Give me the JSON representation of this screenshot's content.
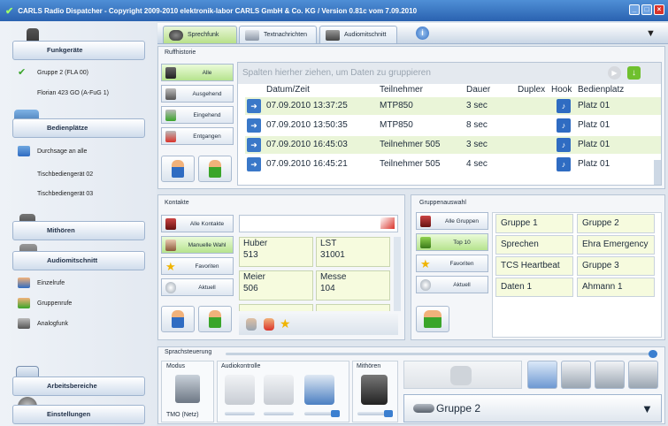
{
  "titlebar": {
    "title": "CARLS Radio Dispatcher   - Copyright 2009-2010 elektronik-labor CARLS GmbH & Co. KG  /  Version 0.81c vom 7.09.2010"
  },
  "sidebar": {
    "funkgeraete": {
      "label": "Funkgeräte",
      "items": [
        "Gruppe 2 (FLA 00)",
        "Florian 423 GO (A-FuG 1)"
      ]
    },
    "bedienplaetze": {
      "label": "Bedienplätze",
      "items": [
        "Durchsage an alle",
        "Tischbediengerät 02",
        "Tischbediengerät 03"
      ]
    },
    "mithoeren": {
      "label": "Mithören"
    },
    "audiomitschnitt": {
      "label": "Audiomitschnitt",
      "items": [
        "Einzelrufe",
        "Gruppenrufe",
        "Analogfunk"
      ]
    },
    "arbeitsbereiche": {
      "label": "Arbeitsbereiche"
    },
    "einstellungen": {
      "label": "Einstellungen"
    }
  },
  "tabs": [
    "Sprechfunk",
    "Textnachrichten",
    "Audiomitschnitt"
  ],
  "ruf": {
    "title": "Ruffhistorie",
    "filters": [
      "Alle",
      "Ausgehend",
      "Eingehend",
      "Entgangen"
    ],
    "grouphint": "Spalten hierher ziehen, um Daten zu gruppieren",
    "columns": [
      "Datum/Zeit",
      "Teilnehmer",
      "Dauer",
      "Duplex",
      "Hook",
      "Bedienplatz"
    ],
    "rows": [
      {
        "dt": "07.09.2010 13:37:25",
        "tn": "MTP850",
        "dauer": "3 sec",
        "bp": "Platz 01"
      },
      {
        "dt": "07.09.2010 13:50:35",
        "tn": "MTP850",
        "dauer": "8 sec",
        "bp": "Platz 01"
      },
      {
        "dt": "07.09.2010 16:45:03",
        "tn": "Teilnehmer 505",
        "dauer": "3 sec",
        "bp": "Platz 01"
      },
      {
        "dt": "07.09.2010 16:45:21",
        "tn": "Teilnehmer 505",
        "dauer": "4 sec",
        "bp": "Platz 01"
      }
    ]
  },
  "kontakte": {
    "title": "Kontakte",
    "filters": [
      "Alle Kontakte",
      "Manuelle Wahl",
      "Favoriten",
      "Aktuell"
    ],
    "cells": [
      {
        "name": "Huber",
        "num": "513"
      },
      {
        "name": "LST",
        "num": "31001"
      },
      {
        "name": "Meier",
        "num": "506"
      },
      {
        "name": "Messe",
        "num": "104"
      }
    ]
  },
  "gruppen": {
    "title": "Gruppenauswahl",
    "filters": [
      "Alle Gruppen",
      "Top 10",
      "Favoriten",
      "Aktuell"
    ],
    "cells": [
      "Gruppe 1",
      "Gruppe 2",
      "Sprechen",
      "Ehra Emergency",
      "TCS Heartbeat",
      "Gruppe 3",
      "Daten 1",
      "Ahmann 1"
    ]
  },
  "sprach": {
    "title": "Sprachsteuerung",
    "modus_label": "Modus",
    "modus_value": "TMO (Netz)",
    "audio_label": "Audiokontrolle",
    "mithoeren_label": "Mithören",
    "selected_group": "Gruppe 2"
  },
  "colors": {
    "accent_green": "#8fd14f",
    "accent_blue": "#2f6cc2",
    "row_green": "#eaf5d8",
    "cell_yellow": "#f6fbde"
  }
}
